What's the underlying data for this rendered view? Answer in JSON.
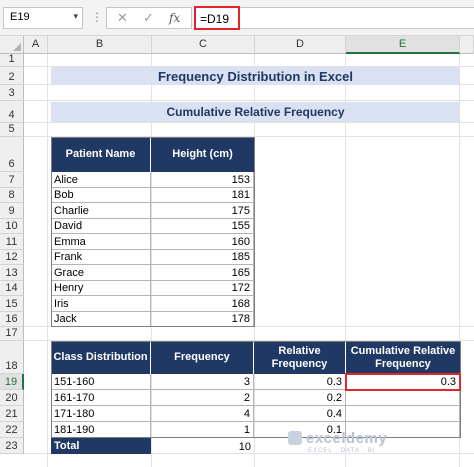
{
  "formula_bar": {
    "name_box": "E19",
    "formula": "=D19",
    "cancel_glyph": "✕",
    "enter_glyph": "✓",
    "fx_glyph": "fx"
  },
  "columns": [
    "A",
    "B",
    "C",
    "D",
    "E"
  ],
  "rows": [
    "1",
    "2",
    "3",
    "4",
    "5",
    "6",
    "7",
    "8",
    "9",
    "10",
    "11",
    "12",
    "13",
    "14",
    "15",
    "16",
    "17",
    "18",
    "19",
    "20",
    "21",
    "22",
    "23"
  ],
  "sheet": {
    "title": "Frequency Distribution in Excel",
    "subtitle": "Cumulative Relative Frequency",
    "patients": {
      "headers": [
        "Patient Name",
        "Height (cm)"
      ],
      "rows": [
        [
          "Alice",
          "153"
        ],
        [
          "Bob",
          "181"
        ],
        [
          "Charlie",
          "175"
        ],
        [
          "David",
          "155"
        ],
        [
          "Emma",
          "160"
        ],
        [
          "Frank",
          "185"
        ],
        [
          "Grace",
          "165"
        ],
        [
          "Henry",
          "172"
        ],
        [
          "Iris",
          "168"
        ],
        [
          "Jack",
          "178"
        ]
      ]
    },
    "distribution": {
      "headers": [
        "Class Distribution",
        "Frequency",
        "Relative Frequency",
        "Cumulative Relative Frequency"
      ],
      "rows": [
        [
          "151-160",
          "3",
          "0.3",
          "0.3"
        ],
        [
          "161-170",
          "2",
          "0.2",
          ""
        ],
        [
          "171-180",
          "4",
          "0.4",
          ""
        ],
        [
          "181-190",
          "1",
          "0.1",
          ""
        ]
      ],
      "total_label": "Total",
      "total_value": "10"
    }
  },
  "watermark": {
    "brand": "exceldemy",
    "tagline": "EXCEL · DATA · BI"
  },
  "colors": {
    "navy": "#203864",
    "band": "#d9e1f2",
    "selection": "#e2272a",
    "excel_green": "#217346"
  }
}
